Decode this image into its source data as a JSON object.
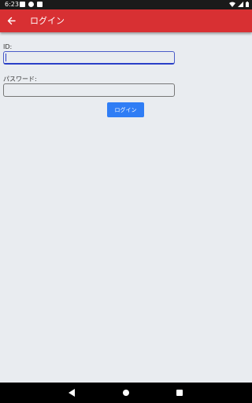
{
  "status_bar": {
    "time": "6:23",
    "notification_icons": [
      "download-icon",
      "app-icon",
      "sim-card-icon"
    ],
    "system_icons": [
      "wifi-icon",
      "signal-icon",
      "battery-icon"
    ]
  },
  "app_bar": {
    "back_icon": "arrow-left-icon",
    "title": "ログイン",
    "color": "#d83033"
  },
  "form": {
    "id_label": "ID:",
    "id_value": "",
    "password_label": "パスワード:",
    "password_value": "",
    "login_button": "ログイン",
    "button_color": "#2f7df5"
  },
  "nav_bar": {
    "buttons": [
      "back-icon",
      "home-icon",
      "recents-icon"
    ]
  }
}
